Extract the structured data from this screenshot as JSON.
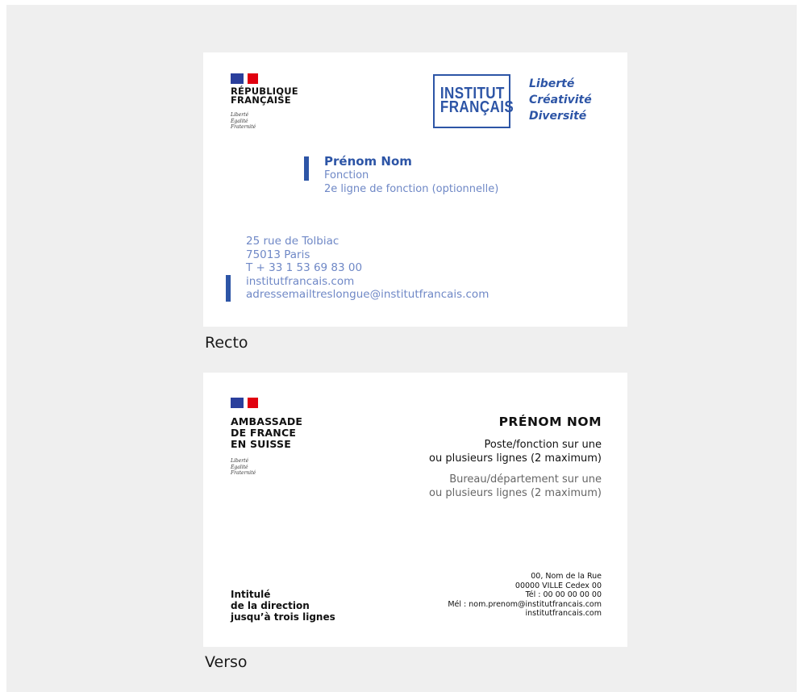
{
  "recto": {
    "caption": "Recto",
    "republique_lines": [
      "RÉPUBLIQUE",
      "FRANÇAISE"
    ],
    "motto": [
      "Liberté",
      "Égalité",
      "Fraternité"
    ],
    "logo_lines": [
      "INSTITUT",
      "FRANÇAIS"
    ],
    "slogan": [
      "Liberté",
      "Créativité",
      "Diversité"
    ],
    "name": "Prénom Nom",
    "function": "Fonction",
    "function2": "2e ligne de fonction (optionnelle)",
    "address": [
      "25 rue de Tolbiac",
      "75013 Paris",
      "T + 33 1 53 69 83 00",
      "institutfrancais.com",
      "adressemailtreslongue@institutfrancais.com"
    ]
  },
  "verso": {
    "caption": "Verso",
    "embassy_lines": [
      "AMBASSADE",
      "DE FRANCE",
      "EN SUISSE"
    ],
    "motto": [
      "Liberté",
      "Égalité",
      "Fraternité"
    ],
    "name": "PRÉNOM NOM",
    "poste": [
      "Poste/fonction sur une",
      "ou plusieurs lignes (2 maximum)"
    ],
    "bureau": [
      "Bureau/département sur une",
      "ou plusieurs lignes (2 maximum)"
    ],
    "direction": [
      "Intitulé",
      "de la direction",
      "jusqu’à trois lignes"
    ],
    "address": [
      "00, Nom de la Rue",
      "00000 VILLE Cedex 00",
      "Tél : 00 00 00 00 00",
      "Mél : nom.prenom@institutfrancais.com",
      "institutfrancais.com"
    ]
  },
  "colors": {
    "flag_blue": "#2a3f9c",
    "flag_red": "#e1000f",
    "if_blue": "#2d55a6",
    "if_light_blue": "#6f88c6"
  }
}
